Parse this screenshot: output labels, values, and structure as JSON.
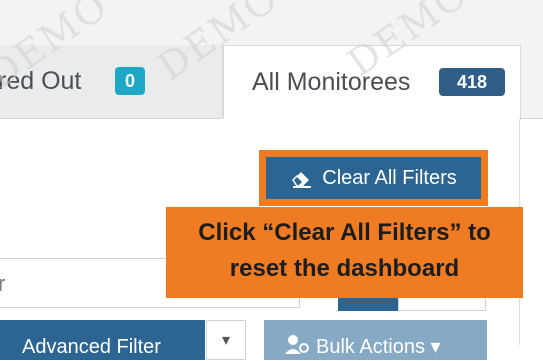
{
  "tabs": {
    "partial_label": "red Out",
    "partial_count": "0",
    "active_label": "All Monitorees",
    "active_count": "418"
  },
  "toolbar": {
    "clear_filters_label": "Clear All Filters",
    "clear_filters_icon": "eraser-icon",
    "search_placeholder_fragment": "r",
    "advanced_filter_label": "Advanced Filter",
    "advanced_filter_caret": "▾",
    "bulk_actions_label": "Bulk Actions ▾",
    "bulk_actions_icon": "user-cog-icon"
  },
  "callout": {
    "line1": "Click “Clear All Filters” to",
    "line2": "reset the dashboard"
  },
  "watermark": {
    "text": "DEMO"
  },
  "colors": {
    "primary": "#2d6592",
    "badge_teal": "#1fa7c7",
    "badge_navy": "#2f5f86",
    "callout": "#ef7b22"
  }
}
